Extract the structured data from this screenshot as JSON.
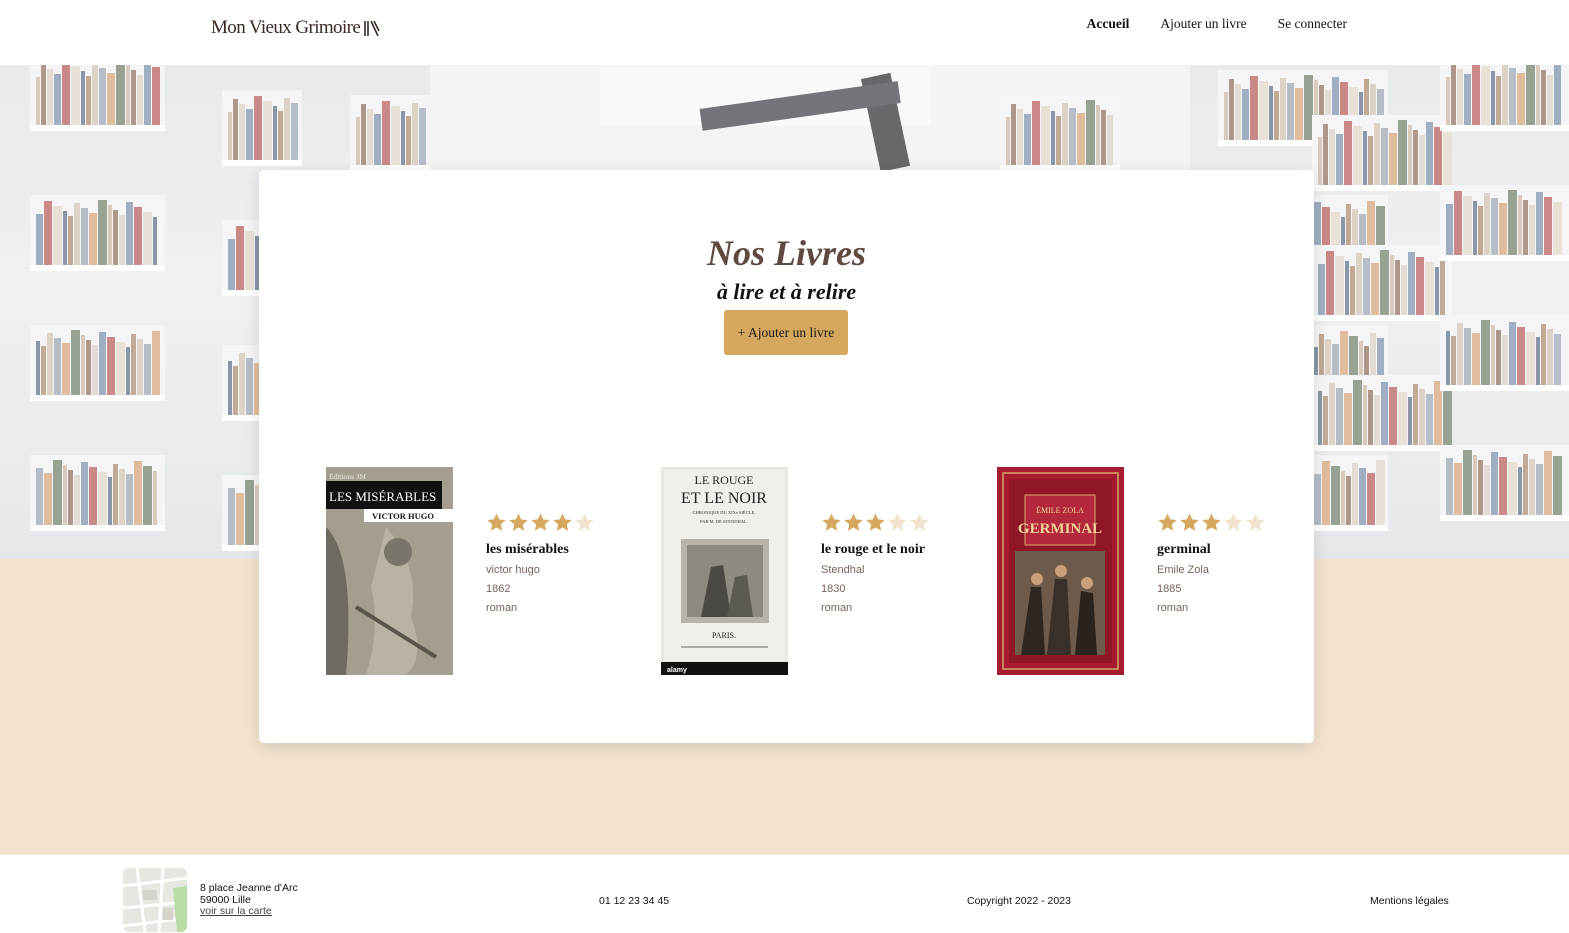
{
  "brand": {
    "name": "Mon Vieux Grimoire",
    "icon": "books-icon"
  },
  "nav": {
    "items": [
      {
        "label": "Accueil",
        "active": true
      },
      {
        "label": "Ajouter un livre",
        "active": false
      },
      {
        "label": "Se connecter",
        "active": false
      }
    ]
  },
  "main": {
    "title": "Nos Livres",
    "subtitle": "à lire et à relire",
    "add_button": "+ Ajouter un livre"
  },
  "books": [
    {
      "title": "les misérables",
      "author": "victor hugo",
      "year": "1862",
      "genre": "roman",
      "rating": 4,
      "cover": {
        "publisher_line": "Éditions 3M",
        "title_line": "LES MISÉRABLES",
        "author_line": "VICTOR HUGO"
      }
    },
    {
      "title": "le rouge et le noir",
      "author": "Stendhal",
      "year": "1830",
      "genre": "roman",
      "rating": 3,
      "cover": {
        "line1": "LE ROUGE",
        "line2": "ET LE NOIR",
        "line3": "CHRONIQUE DU XIXe SIÈCLE,",
        "line4": "PAR M. DE STENDHAL.",
        "line5": "PARIS.",
        "watermark": "alamy"
      }
    },
    {
      "title": "germinal",
      "author": "Emile Zola",
      "year": "1885",
      "genre": "roman",
      "rating": 3,
      "cover": {
        "author_line": "ÉMILE ZOLA",
        "title_line": "GERMINAL"
      }
    }
  ],
  "footer": {
    "address_line1": "8 place Jeanne d'Arc",
    "address_line2": "59000 Lille",
    "map_link": "voir sur la carte",
    "phone": "01 12 23 34 45",
    "copyright": "Copyright 2022 - 2023",
    "legal": "Mentions légales"
  },
  "colors": {
    "accent": "#d6a75e",
    "beige": "#f2e3cf",
    "title": "#5e4a41",
    "star_on": "#d6a75e",
    "star_off": "#f2e3cf"
  }
}
